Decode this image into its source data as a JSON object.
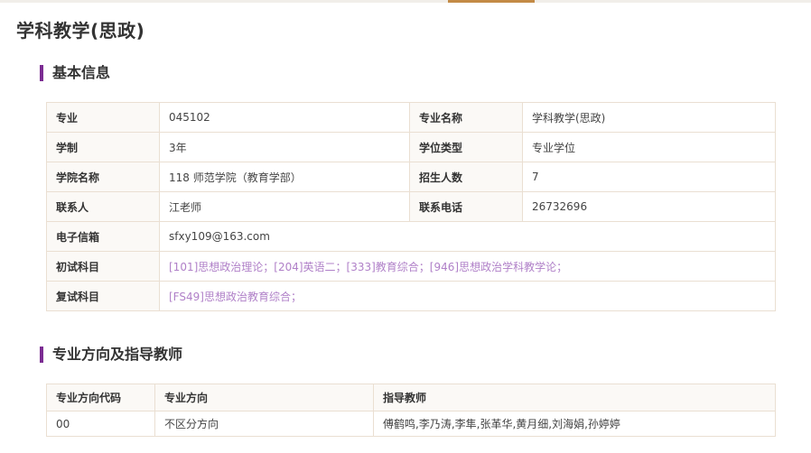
{
  "page": {
    "title": "学科教学(思政)"
  },
  "sections": {
    "basic_info": "基本信息",
    "direction": "专业方向及指导教师"
  },
  "info": {
    "major_label": "专业",
    "major_value": "045102",
    "major_name_label": "专业名称",
    "major_name_value": "学科教学(思政)",
    "duration_label": "学制",
    "duration_value": "3年",
    "degree_type_label": "学位类型",
    "degree_type_value": "专业学位",
    "college_label": "学院名称",
    "college_value": "118 师范学院（教育学部）",
    "enroll_label": "招生人数",
    "enroll_value": "7",
    "contact_label": "联系人",
    "contact_value": "江老师",
    "phone_label": "联系电话",
    "phone_value": "26732696",
    "email_label": "电子信箱",
    "email_value": "sfxy109@163.com",
    "prelim_label": "初试科目",
    "prelim_value": "[101]思想政治理论；[204]英语二；[333]教育综合；[946]思想政治学科教学论；",
    "retest_label": "复试科目",
    "retest_value": "[FS49]思想政治教育综合；"
  },
  "directions": {
    "headers": [
      "专业方向代码",
      "专业方向",
      "指导教师"
    ],
    "rows": [
      [
        "00",
        "不区分方向",
        "傅鹤鸣,李乃涛,李隼,张革华,黄月细,刘海娟,孙婷婷"
      ]
    ]
  },
  "colors": {
    "accent": "#7b2c92",
    "tab_indicator": "#c38b46",
    "link": "#b080c8"
  }
}
